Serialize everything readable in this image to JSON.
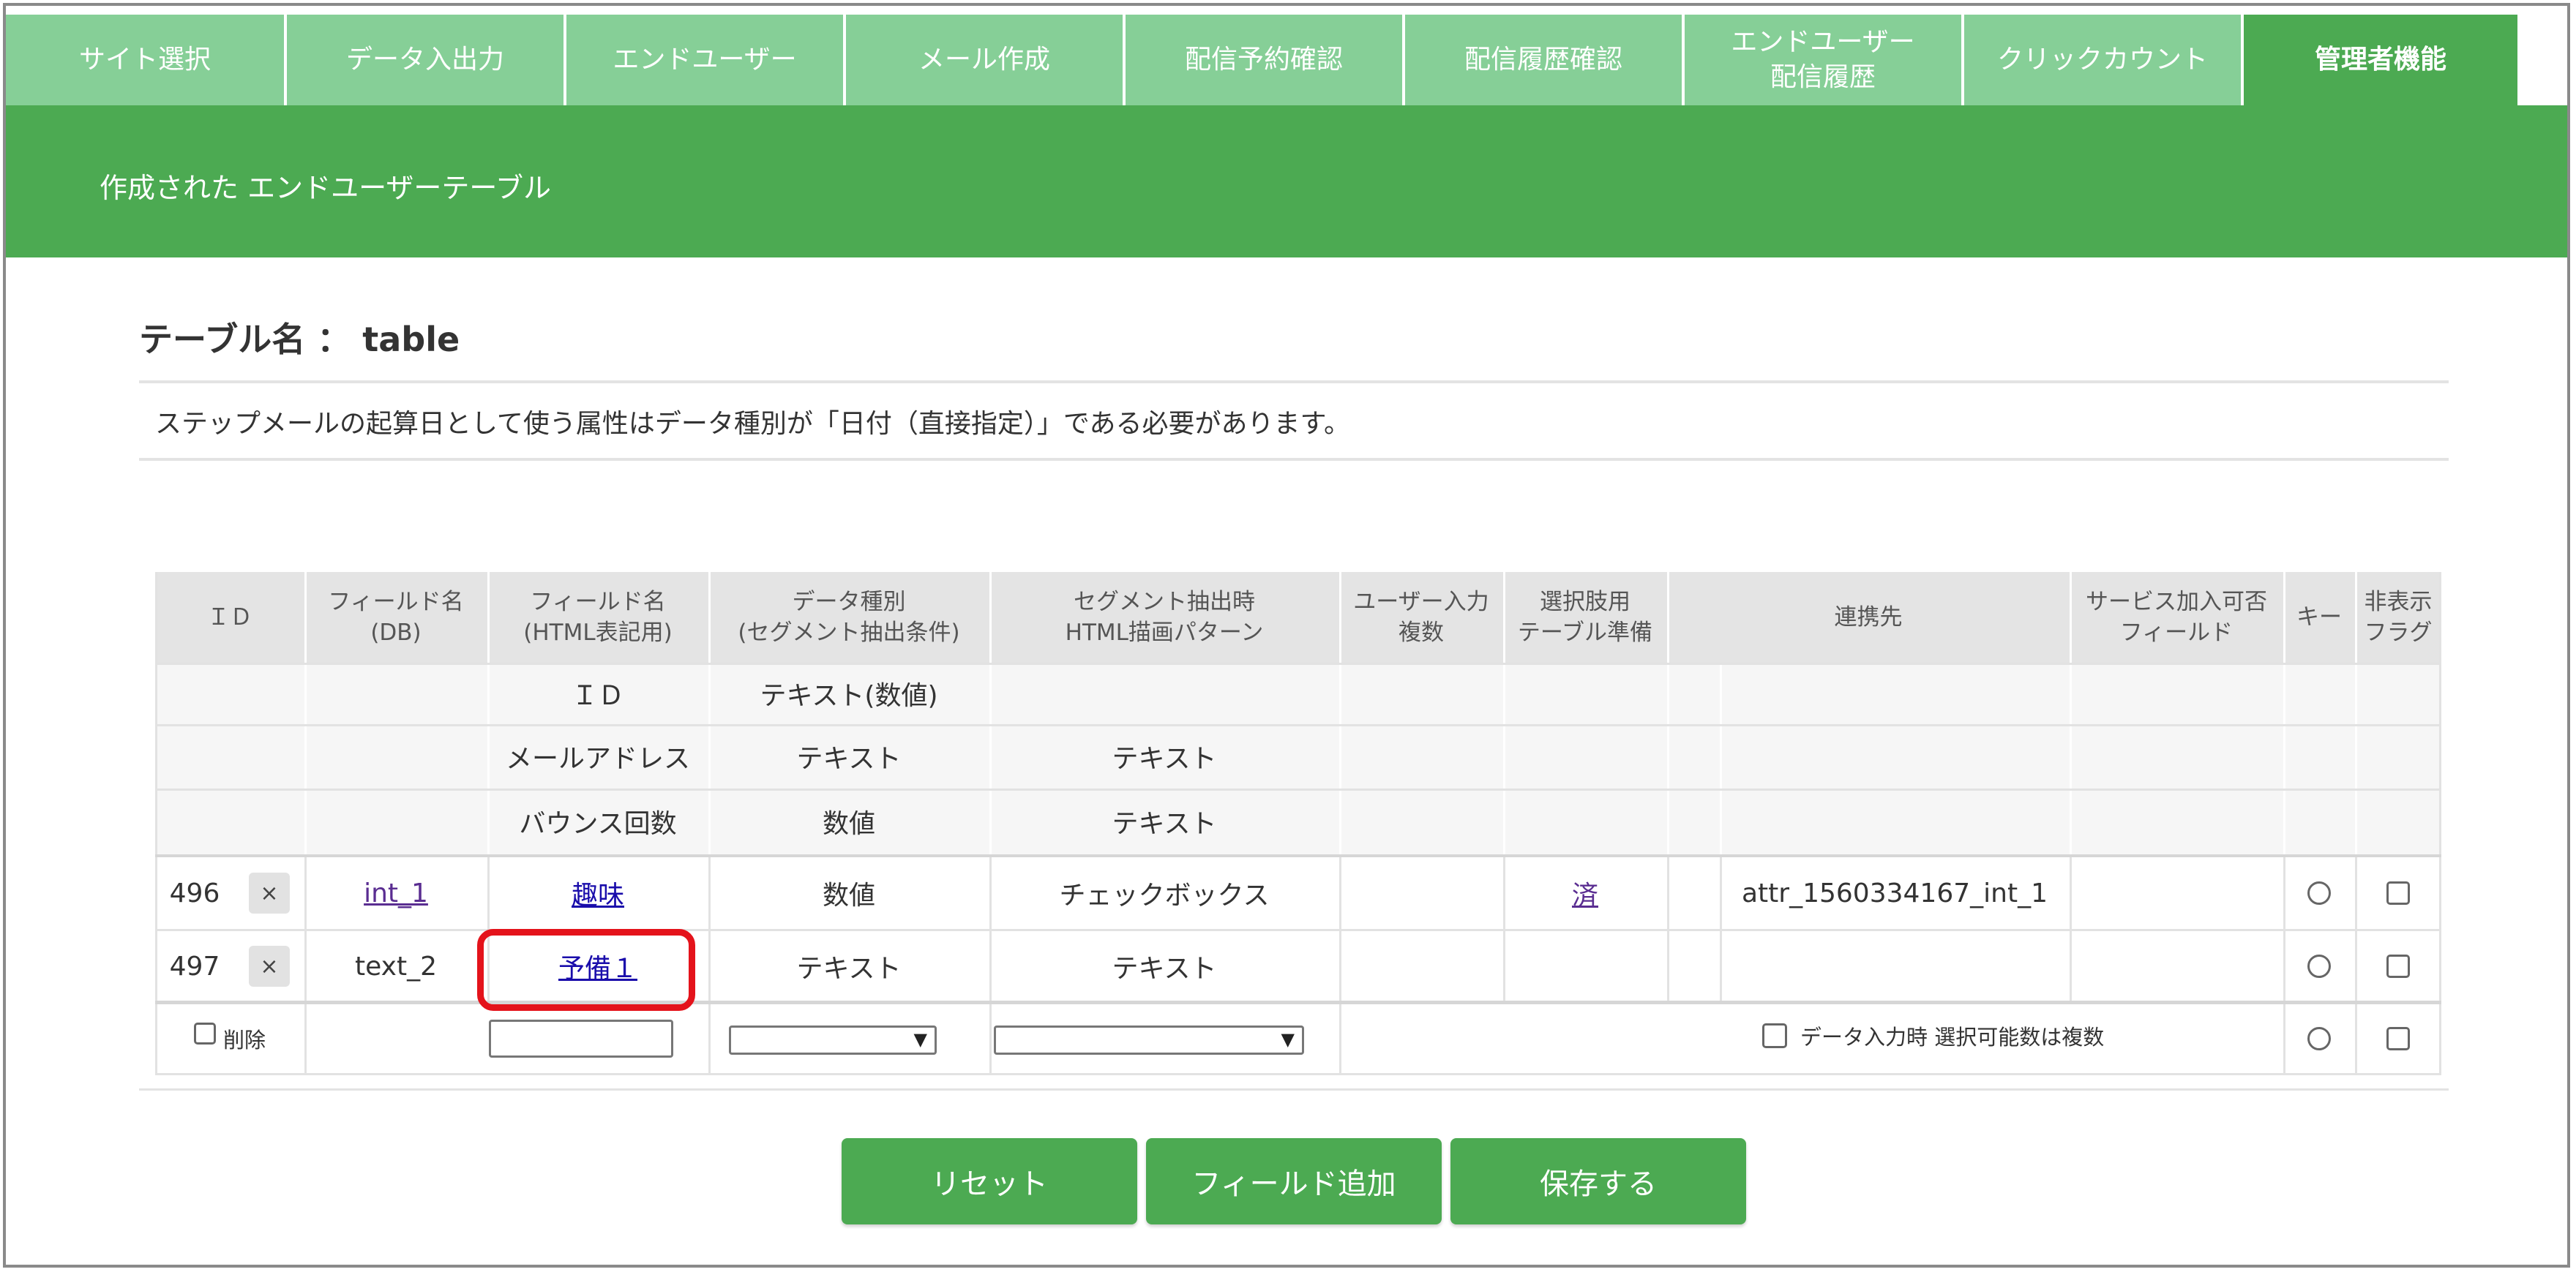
{
  "tabs": [
    {
      "label": "サイト選択"
    },
    {
      "label": "データ入出力"
    },
    {
      "label": "エンドユーザー"
    },
    {
      "label": "メール作成"
    },
    {
      "label": "配信予約確認"
    },
    {
      "label": "配信履歴確認"
    },
    {
      "label": "エンドユーザー\n配信履歴"
    },
    {
      "label": "クリックカウント"
    },
    {
      "label": "管理者機能",
      "active": true
    }
  ],
  "banner": {
    "title": "作成された エンドユーザーテーブル"
  },
  "table_name": "テーブル名 ： table",
  "note": "ステップメールの起算日として使う属性はデータ種別が「日付（直接指定）」である必要があります。",
  "columns": {
    "id": "ＩＤ",
    "field_db": "フィールド名\n(DB)",
    "field_html": "フィールド名\n(HTML表記用)",
    "data_type": "データ種別\n(セグメント抽出条件)",
    "segment": "セグメント抽出時\nHTML描画パターン",
    "user_input": "ユーザー入力\n複数",
    "choice": "選択肢用\nテーブル準備",
    "link_dest": "連携先",
    "service": "サービス加入可否\nフィールド",
    "key": "キー",
    "hidden": "非表示\nフラグ"
  },
  "fixed_rows": [
    {
      "html_name": "ＩＤ",
      "data_type": "テキスト(数値)",
      "segment": ""
    },
    {
      "html_name": "メールアドレス",
      "data_type": "テキスト",
      "segment": "テキスト"
    },
    {
      "html_name": "バウンス回数",
      "data_type": "数値",
      "segment": "テキスト"
    }
  ],
  "rows": [
    {
      "id": "496",
      "delete_mark": "×",
      "db_name": "int_1",
      "html_name": "趣味",
      "data_type": "数値",
      "segment": "チェックボックス",
      "choice": "済",
      "link_dest": "attr_1560334167_int_1"
    },
    {
      "id": "497",
      "delete_mark": "×",
      "db_name": "text_2",
      "html_name": "予備１",
      "data_type": "テキスト",
      "segment": "テキスト",
      "choice": "",
      "link_dest": ""
    }
  ],
  "new_row": {
    "delete_label": "削除",
    "multi_label": "データ入力時 選択可能数は複数"
  },
  "buttons": {
    "reset": "リセット",
    "add_field": "フィールド追加",
    "save": "保存する"
  },
  "colors": {
    "tab": "#86cf97",
    "tab_active": "#4caa52",
    "banner": "#4caa52",
    "highlight": "#e4131b"
  }
}
